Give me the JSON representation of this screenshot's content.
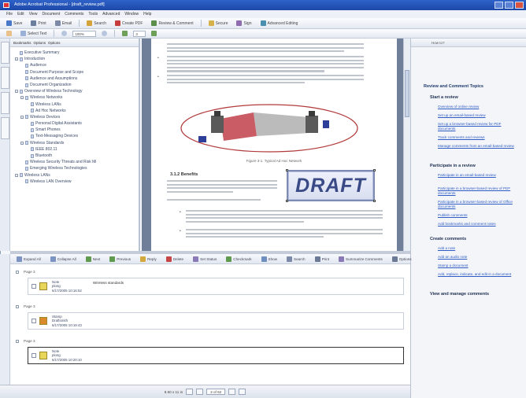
{
  "window": {
    "title": "Adobe Acrobat Professional - [draft_review.pdf]"
  },
  "menu": [
    "File",
    "Edit",
    "View",
    "Document",
    "Comments",
    "Tools",
    "Advanced",
    "Window",
    "Help"
  ],
  "toolbar1": {
    "buttons": [
      "Save",
      "Print",
      "Email",
      "Search",
      "Create PDF",
      "Review & Comment",
      "Secure",
      "Sign",
      "Advanced Editing"
    ]
  },
  "toolbar2": {
    "zoom": "100%",
    "page": "3",
    "select_label": "Select Text"
  },
  "bookmarks": {
    "toolbar": [
      "Bookmarks",
      "Options",
      "Options"
    ],
    "items": [
      {
        "label": "Executive Summary",
        "indent": 0,
        "expander": false
      },
      {
        "label": "Introduction",
        "indent": 0,
        "expander": true
      },
      {
        "label": "Audience",
        "indent": 1,
        "expander": false
      },
      {
        "label": "Document Purpose and Scope",
        "indent": 1,
        "expander": false
      },
      {
        "label": "Audience and Assumptions",
        "indent": 1,
        "expander": false
      },
      {
        "label": "Document Organization",
        "indent": 1,
        "expander": false
      },
      {
        "label": "Overview of Wireless Technology",
        "indent": 0,
        "expander": true
      },
      {
        "label": "Wireless Networks",
        "indent": 1,
        "expander": true
      },
      {
        "label": "Wireless LANs",
        "indent": 2,
        "expander": false
      },
      {
        "label": "Ad Hoc Networks",
        "indent": 2,
        "expander": false
      },
      {
        "label": "Wireless Devices",
        "indent": 1,
        "expander": true
      },
      {
        "label": "Personal Digital Assistants",
        "indent": 2,
        "expander": false
      },
      {
        "label": "Smart Phones",
        "indent": 2,
        "expander": false
      },
      {
        "label": "Text-Messaging Devices",
        "indent": 2,
        "expander": false
      },
      {
        "label": "Wireless Standards",
        "indent": 1,
        "expander": true
      },
      {
        "label": "IEEE 802.11",
        "indent": 2,
        "expander": false
      },
      {
        "label": "Bluetooth",
        "indent": 2,
        "expander": false
      },
      {
        "label": "Wireless Security Threats and Risk Mi",
        "indent": 1,
        "expander": false
      },
      {
        "label": "Emerging Wireless Technologies",
        "indent": 1,
        "expander": false
      },
      {
        "label": "Wireless LANs",
        "indent": 0,
        "expander": true
      },
      {
        "label": "Wireless LAN Overview",
        "indent": 1,
        "expander": false
      }
    ]
  },
  "document": {
    "figure_caption": "Figure 3-1. Typical Ad Hoc Network",
    "heading": "3.1.2  Benefits",
    "stamp": "DRAFT"
  },
  "taskpane": {
    "top_label": "How to?",
    "title": "Review and Comment Topics",
    "sections": [
      {
        "title": "Start a review",
        "links": [
          "Overview of online review",
          "Set up an email-based review",
          "Set up a browser-based review for PDF documents",
          "Track comments and reviews",
          "Manage comments from an email-based review"
        ]
      },
      {
        "title": "Participate in a review",
        "links": [
          "Participate in an email-based review",
          "Participate in a browser-based review of PDF documents",
          "Participate in a browser-based review of Office documents",
          "Publish comments",
          "Add bookmarks and comment notes"
        ]
      },
      {
        "title": "Create comments",
        "links": [
          "Add a note",
          "Add an audio note",
          "Stamp a document",
          "Add, replace, indicate, and edit in a document"
        ]
      },
      {
        "title": "View and manage comments",
        "links": []
      }
    ]
  },
  "comments": {
    "toolbar": [
      "Expand All",
      "Collapse All",
      "Next",
      "Previous",
      "Reply",
      "Delete",
      "Set Status",
      "Checkmark",
      "Show",
      "Search",
      "Print",
      "Summarize Comments",
      "Options"
    ],
    "pages": [
      {
        "label": "Page 3",
        "items": [
          {
            "type": "Note",
            "author": "plong",
            "date": "6/17/2005 10:16:52",
            "text": "Wireless standards",
            "icon": "note"
          }
        ]
      },
      {
        "label": "Page 3",
        "items": [
          {
            "type": "Stamp",
            "author": "Draftsmith",
            "date": "6/17/2005 10:19:43",
            "text": "",
            "icon": "stamp"
          }
        ]
      },
      {
        "label": "Page 3",
        "items": [
          {
            "type": "Note",
            "author": "plong",
            "date": "6/17/2005 10:20:10",
            "text": "",
            "icon": "note",
            "selected": true
          }
        ]
      }
    ]
  },
  "status": {
    "page_display": "3 of 62",
    "size": "8.50 x 11 in"
  },
  "colors": {
    "titlebar": "#2f62c8",
    "stamp_text": "#3a4a86",
    "link": "#2f5cc4"
  }
}
